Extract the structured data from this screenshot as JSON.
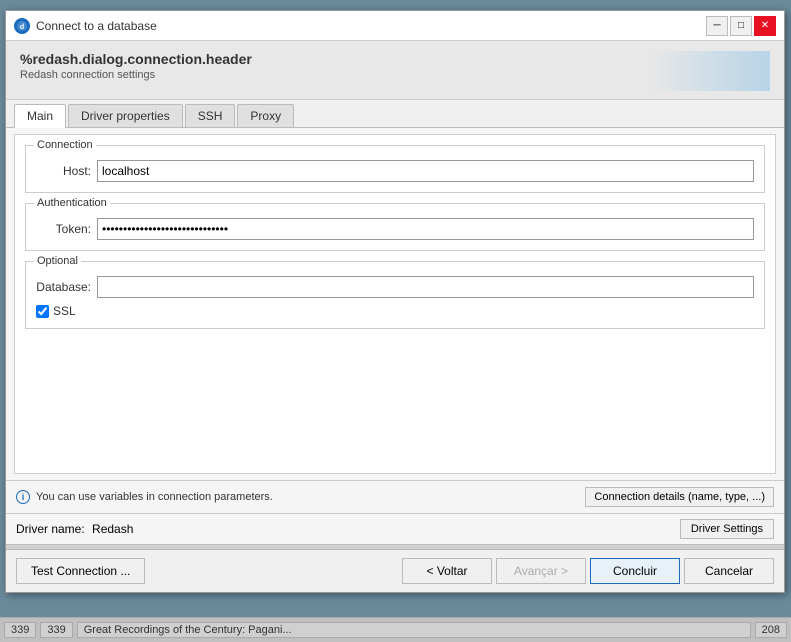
{
  "titleBar": {
    "icon": "db",
    "title": "Connect to a database",
    "minimizeLabel": "─",
    "maximizeLabel": "□",
    "closeLabel": "✕"
  },
  "header": {
    "title": "%redash.dialog.connection.header",
    "subtitle": "Redash connection settings"
  },
  "tabs": [
    {
      "label": "Main",
      "active": true
    },
    {
      "label": "Driver properties",
      "active": false
    },
    {
      "label": "SSH",
      "active": false
    },
    {
      "label": "Proxy",
      "active": false
    }
  ],
  "sections": {
    "connection": {
      "label": "Connection",
      "hostLabel": "Host:",
      "hostValue": "localhost"
    },
    "authentication": {
      "label": "Authentication",
      "tokenLabel": "Token:",
      "tokenValue": "••••••••••••••••••••••••••••••"
    },
    "optional": {
      "label": "Optional",
      "databaseLabel": "Database:",
      "databaseValue": "",
      "sslLabel": "SSL",
      "sslChecked": true
    }
  },
  "infoBar": {
    "message": "You can use variables in connection parameters.",
    "detailsButton": "Connection details (name, type, ...)"
  },
  "driverBar": {
    "label": "Driver name:",
    "driverName": "Redash",
    "settingsButton": "Driver Settings"
  },
  "buttons": {
    "testConnection": "Test Connection ...",
    "back": "< Voltar",
    "next": "Avançar >",
    "finish": "Concluir",
    "cancel": "Cancelar"
  },
  "taskbar": {
    "col1": "339",
    "col2": "339",
    "col3": "Great Recordings of the Century: Pagani...",
    "col4": "208"
  }
}
